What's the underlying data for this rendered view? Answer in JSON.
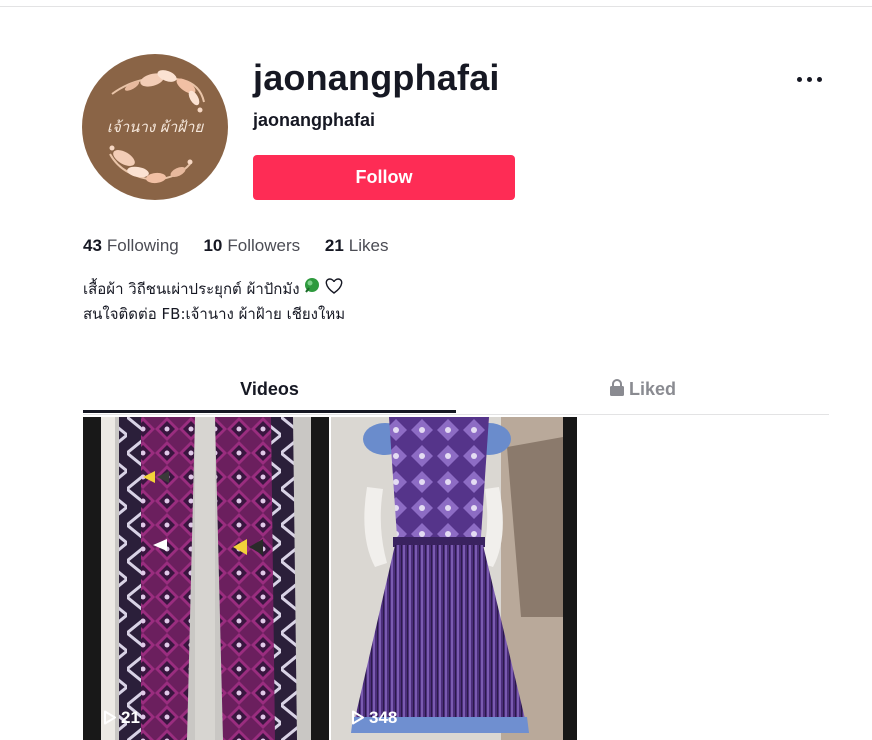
{
  "profile": {
    "avatar_text": "เจ้านาง ผ้าฝ้าย",
    "username": "jaonangphafai",
    "nickname": "jaonangphafai",
    "follow_label": "Follow",
    "more_icon": "more-horizontal-icon"
  },
  "stats": {
    "following": {
      "count": "43",
      "label": "Following"
    },
    "followers": {
      "count": "10",
      "label": "Followers"
    },
    "likes": {
      "count": "21",
      "label": "Likes"
    }
  },
  "bio": {
    "line1": "เสื้อผ้า วิถีชนเผ่าประยุกต์ ผ้าปักมัง",
    "line1_icons": [
      "green-pin-emoji",
      "heart-icon"
    ],
    "line2": "สนใจติดต่อ FB:เจ้านาง ผ้าฝ้าย เชียงใหม"
  },
  "tabs": {
    "videos": "Videos",
    "liked": "Liked",
    "active": "videos"
  },
  "videos": [
    {
      "views": "21"
    },
    {
      "views": "348"
    }
  ],
  "colors": {
    "accent": "#fe2c55",
    "text": "#161823",
    "avatar_bg": "#8a6446"
  }
}
